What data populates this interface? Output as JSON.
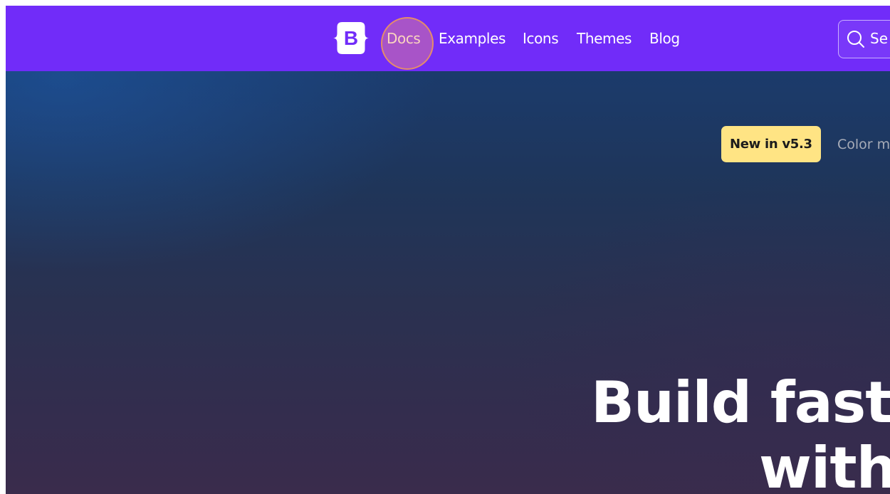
{
  "navbar": {
    "bg_color": "#712cf9",
    "brand_logo_letter": "B",
    "links": [
      {
        "label": "Docs",
        "active": true
      },
      {
        "label": "Examples"
      },
      {
        "label": "Icons"
      },
      {
        "label": "Themes"
      },
      {
        "label": "Blog"
      }
    ],
    "search_partial_text": "Se",
    "search_icon": "search-icon"
  },
  "hero": {
    "badge_label": "New in v5.3",
    "badge_color": "#ffe484",
    "badge_text_partial": "Color m",
    "title_line1": "Build fast,",
    "title_line2": "with"
  }
}
